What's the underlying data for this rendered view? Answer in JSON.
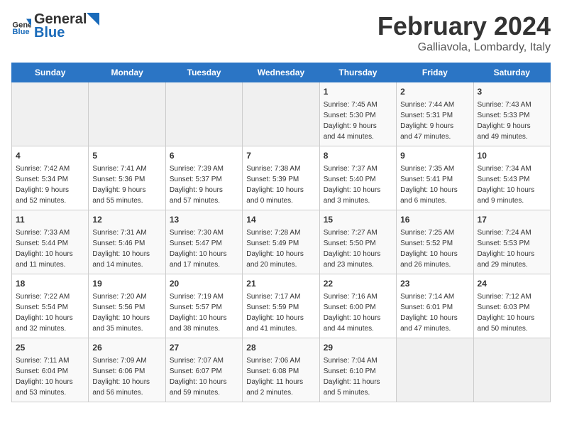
{
  "header": {
    "logo_general": "General",
    "logo_blue": "Blue",
    "title": "February 2024",
    "subtitle": "Galliavola, Lombardy, Italy"
  },
  "days_of_week": [
    "Sunday",
    "Monday",
    "Tuesday",
    "Wednesday",
    "Thursday",
    "Friday",
    "Saturday"
  ],
  "weeks": [
    [
      {
        "day": "",
        "info": ""
      },
      {
        "day": "",
        "info": ""
      },
      {
        "day": "",
        "info": ""
      },
      {
        "day": "",
        "info": ""
      },
      {
        "day": "1",
        "info": "Sunrise: 7:45 AM\nSunset: 5:30 PM\nDaylight: 9 hours\nand 44 minutes."
      },
      {
        "day": "2",
        "info": "Sunrise: 7:44 AM\nSunset: 5:31 PM\nDaylight: 9 hours\nand 47 minutes."
      },
      {
        "day": "3",
        "info": "Sunrise: 7:43 AM\nSunset: 5:33 PM\nDaylight: 9 hours\nand 49 minutes."
      }
    ],
    [
      {
        "day": "4",
        "info": "Sunrise: 7:42 AM\nSunset: 5:34 PM\nDaylight: 9 hours\nand 52 minutes."
      },
      {
        "day": "5",
        "info": "Sunrise: 7:41 AM\nSunset: 5:36 PM\nDaylight: 9 hours\nand 55 minutes."
      },
      {
        "day": "6",
        "info": "Sunrise: 7:39 AM\nSunset: 5:37 PM\nDaylight: 9 hours\nand 57 minutes."
      },
      {
        "day": "7",
        "info": "Sunrise: 7:38 AM\nSunset: 5:39 PM\nDaylight: 10 hours\nand 0 minutes."
      },
      {
        "day": "8",
        "info": "Sunrise: 7:37 AM\nSunset: 5:40 PM\nDaylight: 10 hours\nand 3 minutes."
      },
      {
        "day": "9",
        "info": "Sunrise: 7:35 AM\nSunset: 5:41 PM\nDaylight: 10 hours\nand 6 minutes."
      },
      {
        "day": "10",
        "info": "Sunrise: 7:34 AM\nSunset: 5:43 PM\nDaylight: 10 hours\nand 9 minutes."
      }
    ],
    [
      {
        "day": "11",
        "info": "Sunrise: 7:33 AM\nSunset: 5:44 PM\nDaylight: 10 hours\nand 11 minutes."
      },
      {
        "day": "12",
        "info": "Sunrise: 7:31 AM\nSunset: 5:46 PM\nDaylight: 10 hours\nand 14 minutes."
      },
      {
        "day": "13",
        "info": "Sunrise: 7:30 AM\nSunset: 5:47 PM\nDaylight: 10 hours\nand 17 minutes."
      },
      {
        "day": "14",
        "info": "Sunrise: 7:28 AM\nSunset: 5:49 PM\nDaylight: 10 hours\nand 20 minutes."
      },
      {
        "day": "15",
        "info": "Sunrise: 7:27 AM\nSunset: 5:50 PM\nDaylight: 10 hours\nand 23 minutes."
      },
      {
        "day": "16",
        "info": "Sunrise: 7:25 AM\nSunset: 5:52 PM\nDaylight: 10 hours\nand 26 minutes."
      },
      {
        "day": "17",
        "info": "Sunrise: 7:24 AM\nSunset: 5:53 PM\nDaylight: 10 hours\nand 29 minutes."
      }
    ],
    [
      {
        "day": "18",
        "info": "Sunrise: 7:22 AM\nSunset: 5:54 PM\nDaylight: 10 hours\nand 32 minutes."
      },
      {
        "day": "19",
        "info": "Sunrise: 7:20 AM\nSunset: 5:56 PM\nDaylight: 10 hours\nand 35 minutes."
      },
      {
        "day": "20",
        "info": "Sunrise: 7:19 AM\nSunset: 5:57 PM\nDaylight: 10 hours\nand 38 minutes."
      },
      {
        "day": "21",
        "info": "Sunrise: 7:17 AM\nSunset: 5:59 PM\nDaylight: 10 hours\nand 41 minutes."
      },
      {
        "day": "22",
        "info": "Sunrise: 7:16 AM\nSunset: 6:00 PM\nDaylight: 10 hours\nand 44 minutes."
      },
      {
        "day": "23",
        "info": "Sunrise: 7:14 AM\nSunset: 6:01 PM\nDaylight: 10 hours\nand 47 minutes."
      },
      {
        "day": "24",
        "info": "Sunrise: 7:12 AM\nSunset: 6:03 PM\nDaylight: 10 hours\nand 50 minutes."
      }
    ],
    [
      {
        "day": "25",
        "info": "Sunrise: 7:11 AM\nSunset: 6:04 PM\nDaylight: 10 hours\nand 53 minutes."
      },
      {
        "day": "26",
        "info": "Sunrise: 7:09 AM\nSunset: 6:06 PM\nDaylight: 10 hours\nand 56 minutes."
      },
      {
        "day": "27",
        "info": "Sunrise: 7:07 AM\nSunset: 6:07 PM\nDaylight: 10 hours\nand 59 minutes."
      },
      {
        "day": "28",
        "info": "Sunrise: 7:06 AM\nSunset: 6:08 PM\nDaylight: 11 hours\nand 2 minutes."
      },
      {
        "day": "29",
        "info": "Sunrise: 7:04 AM\nSunset: 6:10 PM\nDaylight: 11 hours\nand 5 minutes."
      },
      {
        "day": "",
        "info": ""
      },
      {
        "day": "",
        "info": ""
      }
    ]
  ]
}
